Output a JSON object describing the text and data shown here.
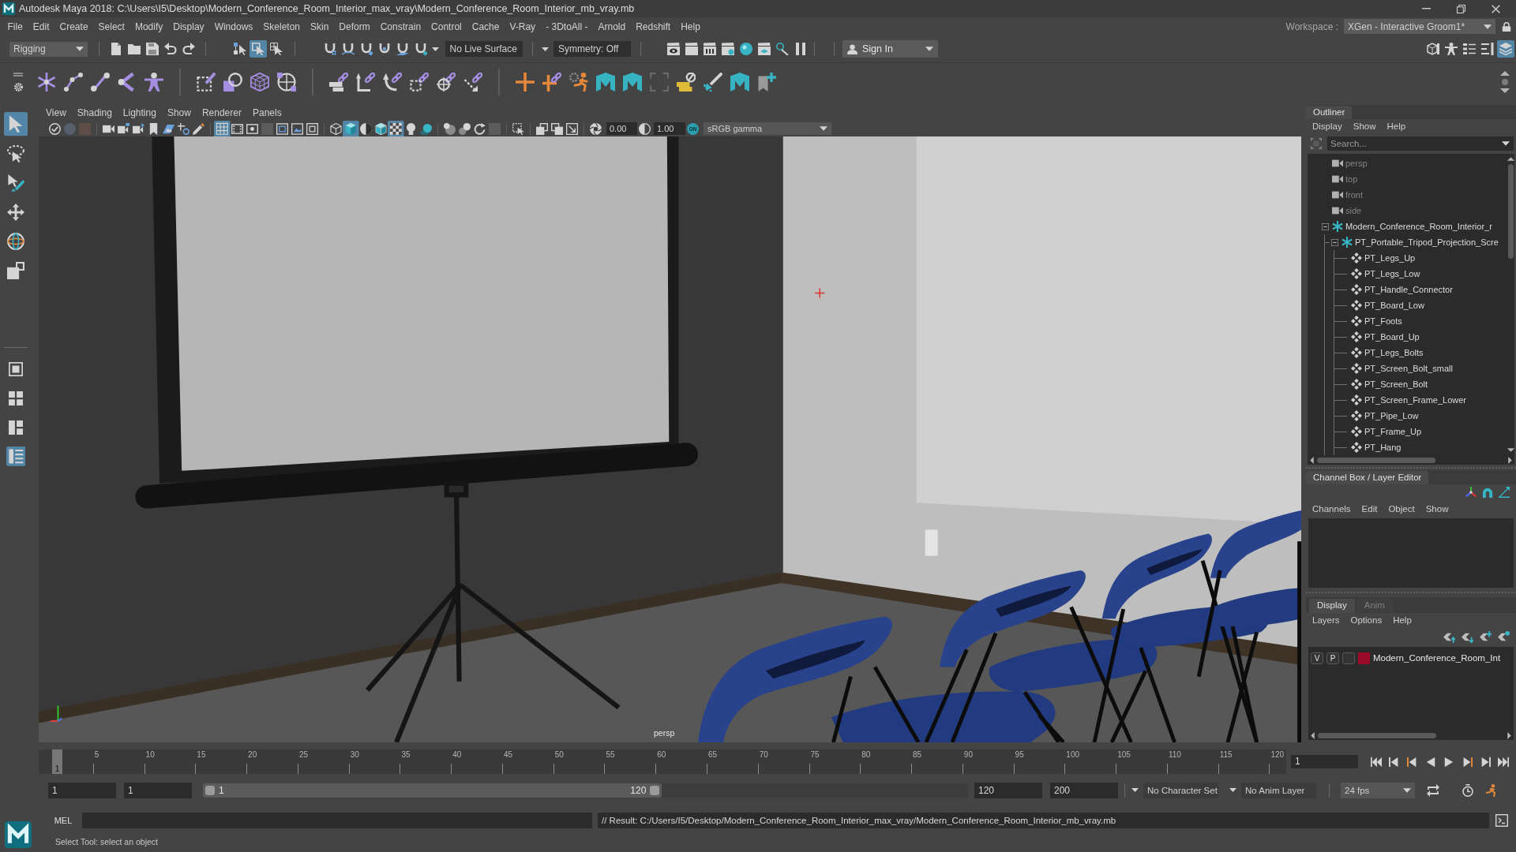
{
  "window": {
    "title": "Autodesk Maya 2018: C:\\Users\\I5\\Desktop\\Modern_Conference_Room_Interior_max_vray\\Modern_Conference_Room_Interior_mb_vray.mb"
  },
  "menu_bar": [
    "File",
    "Edit",
    "Create",
    "Select",
    "Modify",
    "Display",
    "Windows",
    "Skeleton",
    "Skin",
    "Deform",
    "Constrain",
    "Control",
    "Cache",
    "V-Ray",
    "- 3DtoAll -",
    "Arnold",
    "Redshift",
    "Help"
  ],
  "workspace": {
    "label": "Workspace :",
    "value": "XGen - Interactive Groom1*"
  },
  "status_line": {
    "menu_set": "Rigging",
    "selection_modes": [
      {
        "selected": false
      },
      {
        "selected": true
      },
      {
        "selected": false
      }
    ],
    "live_surface": "No Live Surface",
    "symmetry": "Symmetry: Off",
    "sign_in": "Sign In",
    "panel_toggles": [
      {
        "selected": false
      },
      {
        "selected": false
      },
      {
        "selected": false
      },
      {
        "selected": false
      },
      {
        "selected": true
      }
    ]
  },
  "toolbox": {
    "tools": [
      {
        "selected": true
      },
      {
        "selected": false
      },
      {
        "selected": false
      },
      {
        "selected": false
      },
      {
        "selected": false
      },
      {
        "selected": false
      }
    ],
    "layouts": [
      {
        "selected": false
      },
      {
        "selected": false
      },
      {
        "selected": false
      },
      {
        "selected": true
      }
    ]
  },
  "viewport": {
    "menus": [
      "View",
      "Shading",
      "Lighting",
      "Show",
      "Renderer",
      "Panels"
    ],
    "toolbar": [
      {
        "on": false
      },
      {
        "on": false
      },
      {
        "on": false
      },
      {
        "on": false
      },
      {
        "on": false
      },
      {
        "on": false
      },
      {
        "on": false
      },
      {
        "on": false
      },
      {
        "on": false
      },
      {
        "on": false
      },
      {
        "on": true
      },
      {
        "on": false
      },
      {
        "on": false
      },
      {
        "on": false
      },
      {
        "on": false
      },
      {
        "on": false
      },
      {
        "on": false
      },
      {
        "on": false
      },
      {
        "on": true
      },
      {
        "on": false
      },
      {
        "on": false
      },
      {
        "on": true
      },
      {
        "on": false
      },
      {
        "on": false
      },
      {
        "on": false
      },
      {
        "on": false
      },
      {
        "on": false
      },
      {
        "on": false
      },
      {
        "on": false
      },
      {
        "on": false
      },
      {
        "on": false
      },
      {
        "on": false
      },
      {
        "on": false
      }
    ],
    "exposure": "0.00",
    "gamma": "1.00",
    "color_management": "ON",
    "color_space": "sRGB gamma",
    "camera": "persp"
  },
  "outliner": {
    "title": "Outliner",
    "menus": [
      "Display",
      "Show",
      "Help"
    ],
    "search": {
      "placeholder": "Search..."
    },
    "items": [
      {
        "kind": "camera",
        "name": "persp",
        "dimmed": true
      },
      {
        "kind": "camera",
        "name": "top",
        "dimmed": true
      },
      {
        "kind": "camera",
        "name": "front",
        "dimmed": true
      },
      {
        "kind": "camera",
        "name": "side",
        "dimmed": true
      },
      {
        "kind": "group",
        "name": "Modern_Conference_Room_Interior_r",
        "dimmed": false,
        "expanded": true,
        "children": [
          {
            "kind": "group",
            "name": "PT_Portable_Tripod_Projection_Scre",
            "dimmed": false,
            "expanded": true,
            "children": [
              {
                "kind": "mesh",
                "name": "PT_Legs_Up",
                "dimmed": false
              },
              {
                "kind": "mesh",
                "name": "PT_Legs_Low",
                "dimmed": false
              },
              {
                "kind": "mesh",
                "name": "PT_Handle_Connector",
                "dimmed": false
              },
              {
                "kind": "mesh",
                "name": "PT_Board_Low",
                "dimmed": false
              },
              {
                "kind": "mesh",
                "name": "PT_Foots",
                "dimmed": false
              },
              {
                "kind": "mesh",
                "name": "PT_Board_Up",
                "dimmed": false
              },
              {
                "kind": "mesh",
                "name": "PT_Legs_Bolts",
                "dimmed": false
              },
              {
                "kind": "mesh",
                "name": "PT_Screen_Bolt_small",
                "dimmed": false
              },
              {
                "kind": "mesh",
                "name": "PT_Screen_Bolt",
                "dimmed": false
              },
              {
                "kind": "mesh",
                "name": "PT_Screen_Frame_Lower",
                "dimmed": false
              },
              {
                "kind": "mesh",
                "name": "PT_Pipe_Low",
                "dimmed": false
              },
              {
                "kind": "mesh",
                "name": "PT_Frame_Up",
                "dimmed": false
              },
              {
                "kind": "mesh",
                "name": "PT_Hang",
                "dimmed": false
              }
            ]
          }
        ]
      }
    ]
  },
  "channel_box": {
    "title": "Channel Box / Layer Editor",
    "menus": [
      "Channels",
      "Edit",
      "Object",
      "Show"
    ]
  },
  "layer_editor": {
    "tabs": [
      {
        "label": "Display",
        "selected": true
      },
      {
        "label": "Anim",
        "selected": false
      }
    ],
    "menus": [
      "Layers",
      "Options",
      "Help"
    ],
    "layers": [
      {
        "visibility": "V",
        "playback": "P",
        "color": "#9b0a28",
        "name": "Modern_Conference_Room_Int"
      }
    ]
  },
  "timeline": {
    "tick_labels": [
      "5",
      "10",
      "15",
      "20",
      "25",
      "30",
      "35",
      "40",
      "45",
      "50",
      "55",
      "60",
      "65",
      "70",
      "75",
      "80",
      "85",
      "90",
      "95",
      "100",
      "105",
      "110",
      "115",
      "120"
    ],
    "level": 0,
    "current_frame": "1",
    "current_frame_field": "1"
  },
  "range_slider": {
    "animation_start": "1",
    "playback_start": "1",
    "level": 0.6,
    "slider_start": "1",
    "slider_end": "120",
    "playback_end": "120",
    "animation_end": "200",
    "character_set": "No Character Set",
    "anim_layer": "No Anim Layer",
    "fps": "24 fps"
  },
  "command_line": {
    "language": "MEL",
    "result": "// Result: C:/Users/I5/Desktop/Modern_Conference_Room_Interior_max_vray/Modern_Conference_Room_Interior_mb_vray.mb"
  },
  "help_line": "Select Tool: select an object"
}
